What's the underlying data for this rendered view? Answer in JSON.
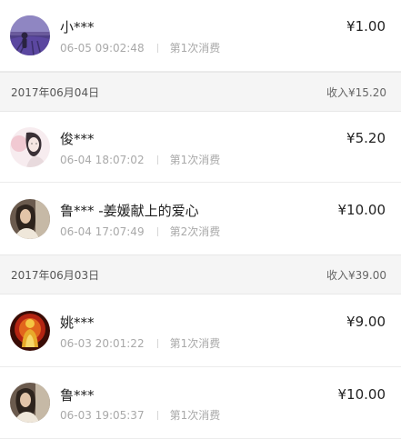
{
  "groups": [
    {
      "entries": [
        {
          "name": "小***",
          "time": "06-05 09:02:48",
          "count": "第1次消费",
          "amount": "¥1.00",
          "avatar": "lavender-field"
        }
      ]
    },
    {
      "date": "2017年06月04日",
      "total": "收入¥15.20",
      "entries": [
        {
          "name": "俊***",
          "time": "06-04 18:07:02",
          "count": "第1次消费",
          "amount": "¥5.20",
          "avatar": "sketch-portrait"
        },
        {
          "name": "鲁*** -姜媛献上的爱心",
          "time": "06-04 17:07:49",
          "count": "第2次消费",
          "amount": "¥10.00",
          "avatar": "woman-portrait"
        }
      ]
    },
    {
      "date": "2017年06月03日",
      "total": "收入¥39.00",
      "entries": [
        {
          "name": "姚***",
          "time": "06-03 20:01:22",
          "count": "第1次消费",
          "amount": "¥9.00",
          "avatar": "golden-buddha"
        },
        {
          "name": "鲁***",
          "time": "06-03 19:05:37",
          "count": "第1次消费",
          "amount": "¥10.00",
          "avatar": "woman-portrait"
        }
      ]
    }
  ]
}
